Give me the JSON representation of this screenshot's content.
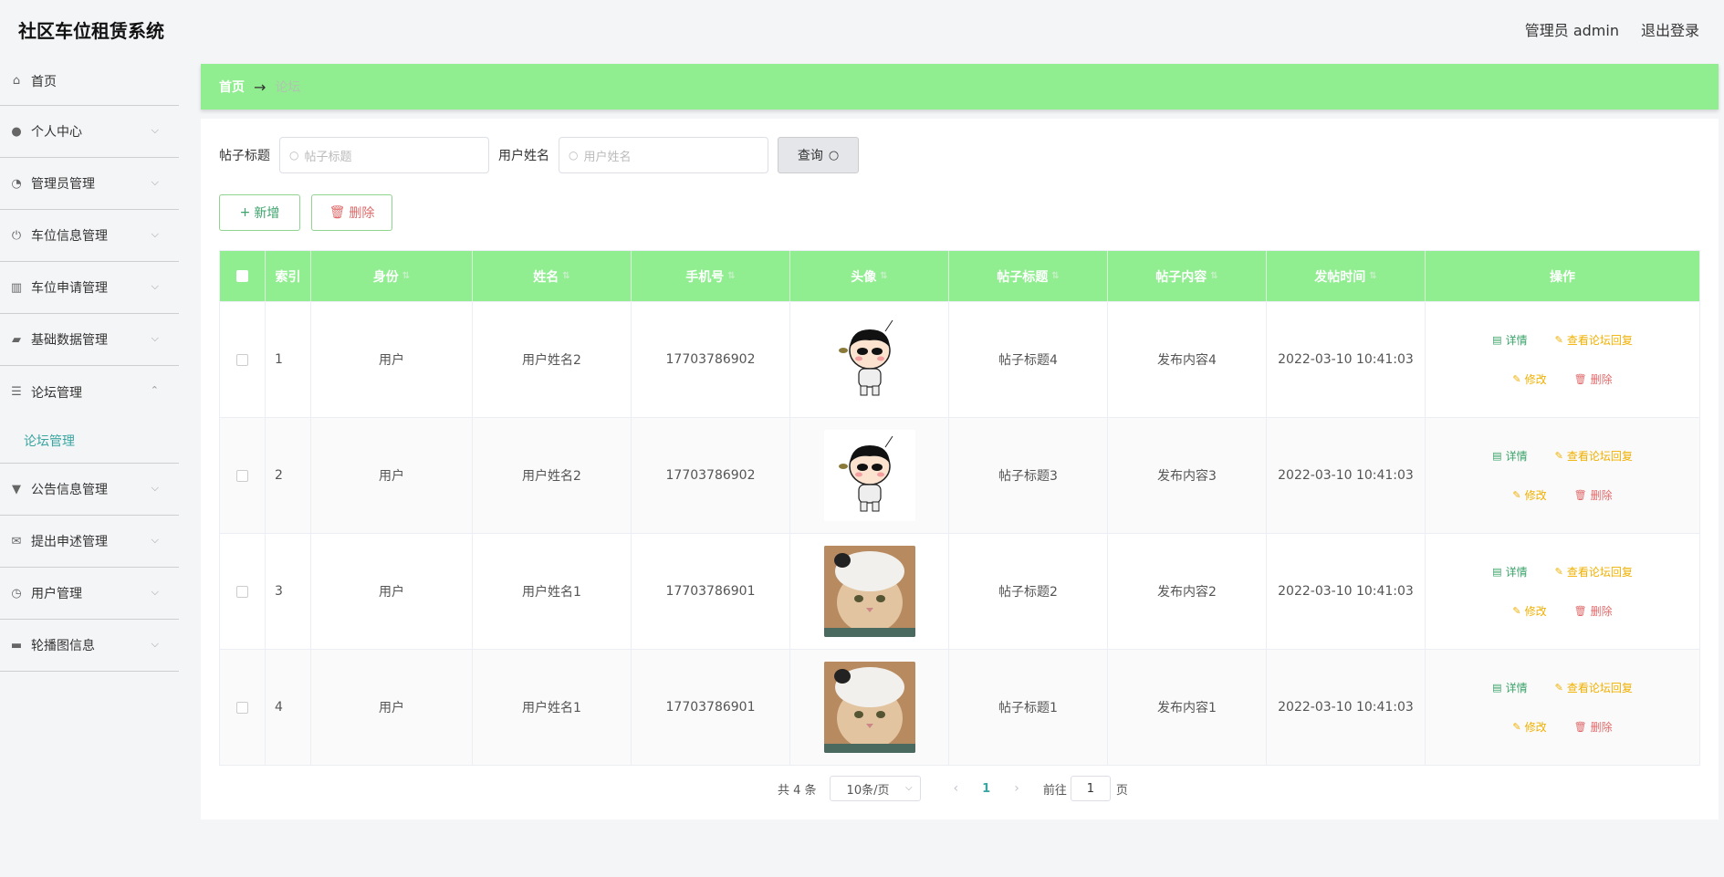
{
  "app": {
    "title": "社区车位租赁系统"
  },
  "header": {
    "user": "管理员 admin",
    "logout": "退出登录"
  },
  "sidebar": {
    "items": [
      {
        "label": "首页",
        "icon": "home-icon",
        "glyph": "⌂",
        "chevron": ""
      },
      {
        "label": "个人中心",
        "icon": "user-icon",
        "glyph": "●",
        "chevron": "⌵"
      },
      {
        "label": "管理员管理",
        "icon": "gauge-icon",
        "glyph": "◔",
        "chevron": "⌵"
      },
      {
        "label": "车位信息管理",
        "icon": "power-icon",
        "glyph": "⏻",
        "chevron": "⌵"
      },
      {
        "label": "车位申请管理",
        "icon": "bar-chart-icon",
        "glyph": "▥",
        "chevron": "⌵"
      },
      {
        "label": "基础数据管理",
        "icon": "ticket-icon",
        "glyph": "▰",
        "chevron": "⌵"
      },
      {
        "label": "论坛管理",
        "icon": "list-icon",
        "glyph": "☰",
        "chevron": "⌃"
      },
      {
        "label": "公告信息管理",
        "icon": "stamp-icon",
        "glyph": "▼",
        "chevron": "⌵"
      },
      {
        "label": "提出申述管理",
        "icon": "mail-icon",
        "glyph": "✉",
        "chevron": "⌵"
      },
      {
        "label": "用户管理",
        "icon": "compass-icon",
        "glyph": "◷",
        "chevron": "⌵"
      },
      {
        "label": "轮播图信息",
        "icon": "monitor-icon",
        "glyph": "▬",
        "chevron": "⌵"
      }
    ],
    "submenu": {
      "label": "论坛管理"
    }
  },
  "breadcrumb": {
    "home": "首页",
    "sep": "→",
    "current": "论坛"
  },
  "search": {
    "title_label": "帖子标题",
    "title_placeholder": "帖子标题",
    "name_label": "用户姓名",
    "name_placeholder": "用户姓名",
    "query": "查询"
  },
  "actions": {
    "add": "新增",
    "delete": "删除"
  },
  "table": {
    "headers": [
      "索引",
      "身份",
      "姓名",
      "手机号",
      "头像",
      "帖子标题",
      "帖子内容",
      "发帖时间",
      "操作"
    ],
    "rows": [
      {
        "index": "1",
        "role": "用户",
        "name": "用户姓名2",
        "phone": "17703786902",
        "avatar": "boy",
        "title": "帖子标题4",
        "content": "发布内容4",
        "time": "2022-03-10 10:41:03"
      },
      {
        "index": "2",
        "role": "用户",
        "name": "用户姓名2",
        "phone": "17703786902",
        "avatar": "boy",
        "title": "帖子标题3",
        "content": "发布内容3",
        "time": "2022-03-10 10:41:03"
      },
      {
        "index": "3",
        "role": "用户",
        "name": "用户姓名1",
        "phone": "17703786901",
        "avatar": "cat",
        "title": "帖子标题2",
        "content": "发布内容2",
        "time": "2022-03-10 10:41:03"
      },
      {
        "index": "4",
        "role": "用户",
        "name": "用户姓名1",
        "phone": "17703786901",
        "avatar": "cat",
        "title": "帖子标题1",
        "content": "发布内容1",
        "time": "2022-03-10 10:41:03"
      }
    ],
    "ops": {
      "detail": "详情",
      "reply": "查看论坛回复",
      "edit": "修改",
      "delete": "删除"
    }
  },
  "pager": {
    "total": "共 4 条",
    "size": "10条/页",
    "page": "1",
    "goto": "前往",
    "goto_value": "1",
    "page_unit": "页"
  },
  "colors": {
    "accent": "#90ee90",
    "submenu": "#3aa5a0",
    "danger": "#e06a6a",
    "warn": "#f0b000"
  }
}
